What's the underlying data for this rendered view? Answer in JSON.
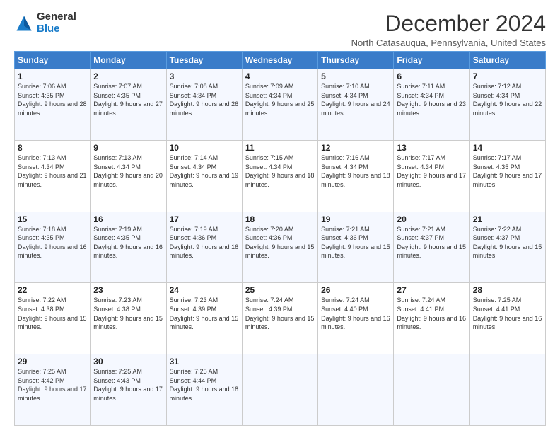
{
  "header": {
    "logo_general": "General",
    "logo_blue": "Blue",
    "title": "December 2024",
    "location": "North Catasauqua, Pennsylvania, United States"
  },
  "weekdays": [
    "Sunday",
    "Monday",
    "Tuesday",
    "Wednesday",
    "Thursday",
    "Friday",
    "Saturday"
  ],
  "weeks": [
    [
      {
        "day": "1",
        "sunrise": "7:06 AM",
        "sunset": "4:35 PM",
        "daylight": "9 hours and 28 minutes."
      },
      {
        "day": "2",
        "sunrise": "7:07 AM",
        "sunset": "4:35 PM",
        "daylight": "9 hours and 27 minutes."
      },
      {
        "day": "3",
        "sunrise": "7:08 AM",
        "sunset": "4:34 PM",
        "daylight": "9 hours and 26 minutes."
      },
      {
        "day": "4",
        "sunrise": "7:09 AM",
        "sunset": "4:34 PM",
        "daylight": "9 hours and 25 minutes."
      },
      {
        "day": "5",
        "sunrise": "7:10 AM",
        "sunset": "4:34 PM",
        "daylight": "9 hours and 24 minutes."
      },
      {
        "day": "6",
        "sunrise": "7:11 AM",
        "sunset": "4:34 PM",
        "daylight": "9 hours and 23 minutes."
      },
      {
        "day": "7",
        "sunrise": "7:12 AM",
        "sunset": "4:34 PM",
        "daylight": "9 hours and 22 minutes."
      }
    ],
    [
      {
        "day": "8",
        "sunrise": "7:13 AM",
        "sunset": "4:34 PM",
        "daylight": "9 hours and 21 minutes."
      },
      {
        "day": "9",
        "sunrise": "7:13 AM",
        "sunset": "4:34 PM",
        "daylight": "9 hours and 20 minutes."
      },
      {
        "day": "10",
        "sunrise": "7:14 AM",
        "sunset": "4:34 PM",
        "daylight": "9 hours and 19 minutes."
      },
      {
        "day": "11",
        "sunrise": "7:15 AM",
        "sunset": "4:34 PM",
        "daylight": "9 hours and 18 minutes."
      },
      {
        "day": "12",
        "sunrise": "7:16 AM",
        "sunset": "4:34 PM",
        "daylight": "9 hours and 18 minutes."
      },
      {
        "day": "13",
        "sunrise": "7:17 AM",
        "sunset": "4:34 PM",
        "daylight": "9 hours and 17 minutes."
      },
      {
        "day": "14",
        "sunrise": "7:17 AM",
        "sunset": "4:35 PM",
        "daylight": "9 hours and 17 minutes."
      }
    ],
    [
      {
        "day": "15",
        "sunrise": "7:18 AM",
        "sunset": "4:35 PM",
        "daylight": "9 hours and 16 minutes."
      },
      {
        "day": "16",
        "sunrise": "7:19 AM",
        "sunset": "4:35 PM",
        "daylight": "9 hours and 16 minutes."
      },
      {
        "day": "17",
        "sunrise": "7:19 AM",
        "sunset": "4:36 PM",
        "daylight": "9 hours and 16 minutes."
      },
      {
        "day": "18",
        "sunrise": "7:20 AM",
        "sunset": "4:36 PM",
        "daylight": "9 hours and 15 minutes."
      },
      {
        "day": "19",
        "sunrise": "7:21 AM",
        "sunset": "4:36 PM",
        "daylight": "9 hours and 15 minutes."
      },
      {
        "day": "20",
        "sunrise": "7:21 AM",
        "sunset": "4:37 PM",
        "daylight": "9 hours and 15 minutes."
      },
      {
        "day": "21",
        "sunrise": "7:22 AM",
        "sunset": "4:37 PM",
        "daylight": "9 hours and 15 minutes."
      }
    ],
    [
      {
        "day": "22",
        "sunrise": "7:22 AM",
        "sunset": "4:38 PM",
        "daylight": "9 hours and 15 minutes."
      },
      {
        "day": "23",
        "sunrise": "7:23 AM",
        "sunset": "4:38 PM",
        "daylight": "9 hours and 15 minutes."
      },
      {
        "day": "24",
        "sunrise": "7:23 AM",
        "sunset": "4:39 PM",
        "daylight": "9 hours and 15 minutes."
      },
      {
        "day": "25",
        "sunrise": "7:24 AM",
        "sunset": "4:39 PM",
        "daylight": "9 hours and 15 minutes."
      },
      {
        "day": "26",
        "sunrise": "7:24 AM",
        "sunset": "4:40 PM",
        "daylight": "9 hours and 16 minutes."
      },
      {
        "day": "27",
        "sunrise": "7:24 AM",
        "sunset": "4:41 PM",
        "daylight": "9 hours and 16 minutes."
      },
      {
        "day": "28",
        "sunrise": "7:25 AM",
        "sunset": "4:41 PM",
        "daylight": "9 hours and 16 minutes."
      }
    ],
    [
      {
        "day": "29",
        "sunrise": "7:25 AM",
        "sunset": "4:42 PM",
        "daylight": "9 hours and 17 minutes."
      },
      {
        "day": "30",
        "sunrise": "7:25 AM",
        "sunset": "4:43 PM",
        "daylight": "9 hours and 17 minutes."
      },
      {
        "day": "31",
        "sunrise": "7:25 AM",
        "sunset": "4:44 PM",
        "daylight": "9 hours and 18 minutes."
      },
      null,
      null,
      null,
      null
    ]
  ]
}
